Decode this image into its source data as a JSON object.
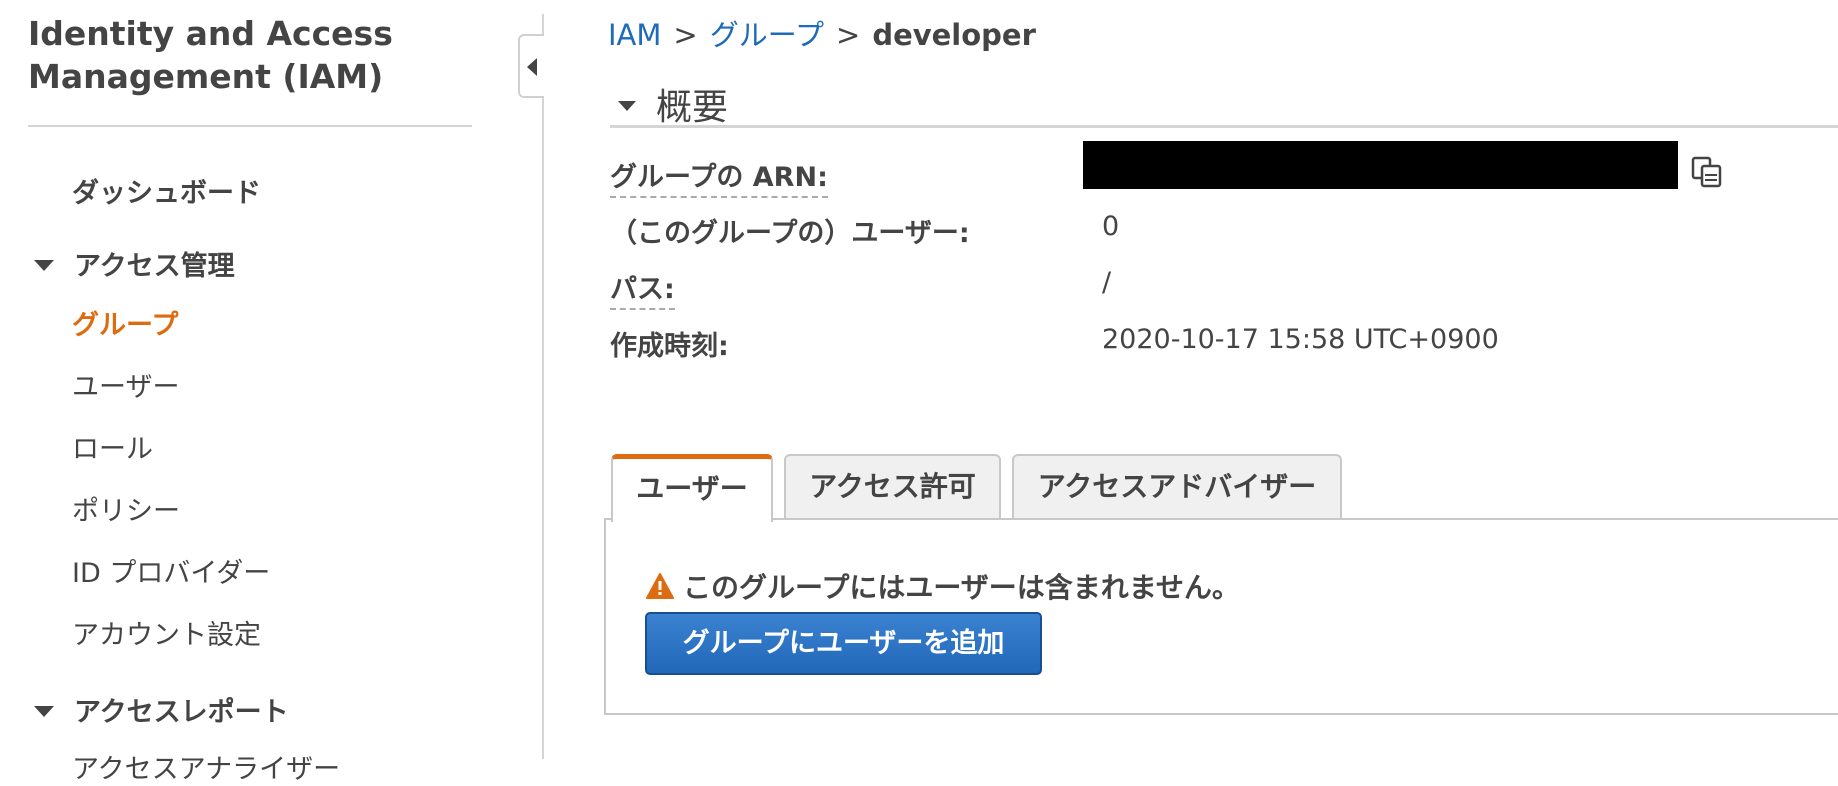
{
  "sidebar": {
    "title_line1": "Identity and Access",
    "title_line2": "Management (IAM)",
    "dashboard": "ダッシュボード",
    "access_management": {
      "heading": "アクセス管理",
      "items": [
        "グループ",
        "ユーザー",
        "ロール",
        "ポリシー",
        "ID プロバイダー",
        "アカウント設定"
      ],
      "active": "グループ"
    },
    "access_reports": {
      "heading": "アクセスレポート",
      "partial_item": "アクセスアナライザー"
    }
  },
  "breadcrumb": {
    "root": "IAM",
    "groups": "グループ",
    "current": "developer",
    "separator": ">"
  },
  "summary": {
    "heading": "概要",
    "fields": {
      "arn_label": "グループの ARN:",
      "users_label": "（このグループの）ユーザー:",
      "users_value": "0",
      "path_label": "パス:",
      "path_value": "/",
      "created_label": "作成時刻:",
      "created_value": "2020-10-17 15:58 UTC+0900"
    },
    "copy_icon": "copy-icon"
  },
  "tabs": {
    "items": [
      "ユーザー",
      "アクセス許可",
      "アクセスアドバイザー"
    ],
    "active": "ユーザー"
  },
  "users_tab": {
    "warning_icon": "warning-icon",
    "warning_text": "このグループにはユーザーは含まれません。",
    "add_button": "グループにユーザーを追加"
  },
  "colors": {
    "link": "#1e6bb8",
    "active_nav": "#dd6b10",
    "primary_button": "#2a6ebd",
    "warning": "#dd6b10"
  }
}
